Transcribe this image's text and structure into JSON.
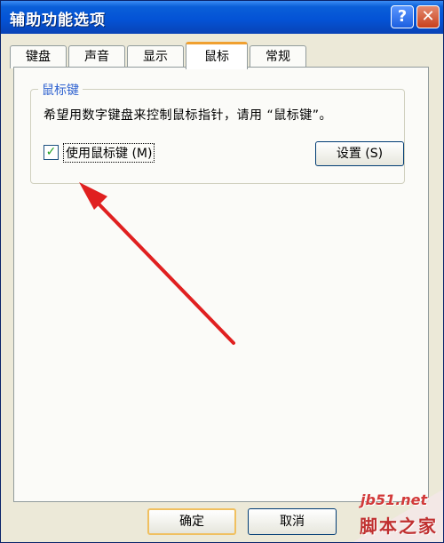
{
  "window": {
    "title": "辅助功能选项",
    "help_label": "?",
    "close_label": "✕"
  },
  "tabs": [
    {
      "label": "键盘"
    },
    {
      "label": "声音"
    },
    {
      "label": "显示"
    },
    {
      "label": "鼠标",
      "active": true
    },
    {
      "label": "常规"
    }
  ],
  "mouse_keys": {
    "group_title": "鼠标键",
    "description": "希望用数字键盘来控制鼠标指针，请用 “鼠标键”。",
    "checkbox_label": "使用鼠标键 (M)",
    "checked": true,
    "check_mark": "✓",
    "settings_label": "设置 (S)"
  },
  "buttons": {
    "ok": "确定",
    "cancel": "取消"
  },
  "watermark": {
    "site": "jb51.net",
    "text": "脚本之家"
  },
  "colors": {
    "arrow": "#e02020",
    "title_bar": "#0453d6",
    "tab_highlight": "#f0a030"
  }
}
